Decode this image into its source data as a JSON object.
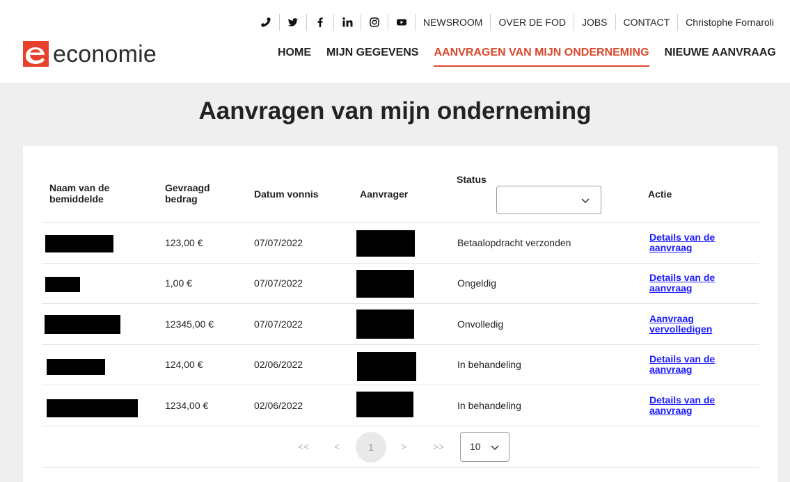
{
  "topbar": {
    "icons": [
      "phone-icon",
      "twitter-icon",
      "facebook-icon",
      "linkedin-icon",
      "instagram-icon",
      "youtube-icon"
    ],
    "links": [
      "NEWSROOM",
      "OVER DE FOD",
      "JOBS",
      "CONTACT"
    ],
    "user": "Christophe Fornaroli"
  },
  "logo": {
    "text": "economie",
    "accent": "#e8412b"
  },
  "nav": {
    "items": [
      "HOME",
      "MIJN GEGEVENS",
      "AANVRAGEN VAN MIJN ONDERNEMING",
      "NIEUWE AANVRAAG"
    ],
    "active": "AANVRAGEN VAN MIJN ONDERNEMING",
    "active_color": "#d9482b"
  },
  "page": {
    "title": "Aanvragen van mijn onderneming"
  },
  "table": {
    "headers": {
      "naam": "Naam van de bemiddelde",
      "bedrag": "Gevraagd bedrag",
      "datum": "Datum vonnis",
      "aanvrager": "Aanvrager",
      "status": "Status",
      "actie": "Actie"
    },
    "status_filter": {
      "value": ""
    },
    "rows": [
      {
        "bedrag": "123,00 €",
        "datum": "07/07/2022",
        "status": "Betaalopdracht verzonden",
        "actie": "Details van de aanvraag"
      },
      {
        "bedrag": "1,00 €",
        "datum": "07/07/2022",
        "status": "Ongeldig",
        "actie": "Details van de aanvraag"
      },
      {
        "bedrag": "12345,00 €",
        "datum": "07/07/2022",
        "status": "Onvolledig",
        "actie": "Aanvraag vervolledigen"
      },
      {
        "bedrag": "124,00 €",
        "datum": "02/06/2022",
        "status": "In behandeling",
        "actie": "Details van de aanvraag"
      },
      {
        "bedrag": "1234,00 €",
        "datum": "02/06/2022",
        "status": "In behandeling",
        "actie": "Details van de aanvraag"
      }
    ]
  },
  "pagination": {
    "first": "<<",
    "prev": "<",
    "current": "1",
    "next": ">",
    "last": ">>",
    "page_size": "10"
  },
  "colors": {
    "link": "#1a1aff",
    "redaction": "#000000"
  }
}
